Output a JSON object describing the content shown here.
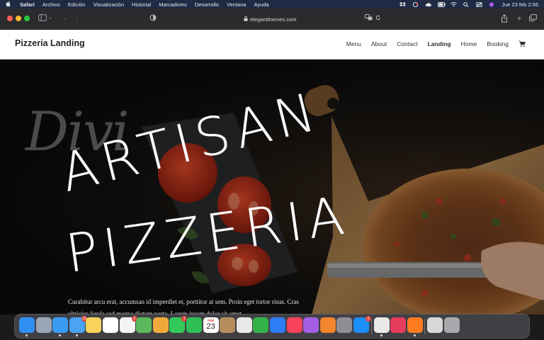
{
  "menubar": {
    "app_name": "Safari",
    "items": [
      "Archivo",
      "Edición",
      "Visualización",
      "Historial",
      "Marcadores",
      "Desarrollo",
      "Ventana",
      "Ayuda"
    ],
    "datetime": "Jue 23 feb 2:56"
  },
  "browser": {
    "url": "elegantthemes.com"
  },
  "site": {
    "title": "Pizzeria Landing",
    "nav": [
      "Menu",
      "About",
      "Contact",
      "Landing",
      "Home",
      "Booking"
    ],
    "active_nav": "Landing"
  },
  "hero": {
    "script_text": "Divi",
    "title_line1": "ARTISAN",
    "title_line2": "PIZZERIA",
    "body": "Curabitur arcu erat, accumsan id imperdiet et, porttitor at sem. Proin eget tortor risus. Cras ultricies ligula sed magna dictum porta. Lorem ipsum dolor sit amet."
  },
  "dock": {
    "apps": [
      {
        "icon": "finder-icon",
        "color": "#2f8ff0",
        "dot": true
      },
      {
        "icon": "launchpad-icon",
        "color": "#9aa5b8"
      },
      {
        "icon": "safari-icon",
        "color": "#3a9bf4",
        "dot": true
      },
      {
        "icon": "mail-icon",
        "color": "#4aa3f5",
        "badge": "10",
        "dot": true
      },
      {
        "icon": "notes-icon",
        "color": "#f7d35c"
      },
      {
        "icon": "freeform-icon",
        "color": "#ffffff"
      },
      {
        "icon": "reminders-icon",
        "color": "#f4f4f4",
        "badge": "2"
      },
      {
        "icon": "maps-icon",
        "color": "#5cb85c"
      },
      {
        "icon": "photos-icon",
        "color": "#f2a93b"
      },
      {
        "icon": "messages-icon",
        "color": "#34c759",
        "badge": "1"
      },
      {
        "icon": "facetime-icon",
        "color": "#2fbf55"
      },
      {
        "icon": "calendar-icon",
        "color": "#ffffff",
        "month": "FEB",
        "day": "23"
      },
      {
        "icon": "contacts-icon",
        "color": "#b68e5e"
      },
      {
        "icon": "keynote-icon",
        "color": "#e8e8e8"
      },
      {
        "icon": "numbers-icon",
        "color": "#33b24a"
      },
      {
        "icon": "keynote-podium-icon",
        "color": "#2e7cf6"
      },
      {
        "icon": "music-icon",
        "color": "#f9425b"
      },
      {
        "icon": "podcasts-icon",
        "color": "#a45ee5"
      },
      {
        "icon": "books-icon",
        "color": "#f3852d"
      },
      {
        "icon": "system-settings-icon",
        "color": "#8e8e93"
      },
      {
        "icon": "app-store-icon",
        "color": "#1c8ef9",
        "badge": "1"
      },
      {
        "icon": "chrome-icon",
        "color": "#e9e9e9",
        "dot": true
      },
      {
        "icon": "creative-cloud-icon",
        "color": "#e53b5c"
      },
      {
        "icon": "firefox-icon",
        "color": "#ff7b22",
        "dot": true
      },
      {
        "icon": "scanner-icon",
        "color": "#d8d8d8"
      },
      {
        "icon": "trash-icon",
        "color": "#a9a9ad"
      }
    ]
  },
  "colors": {
    "menubar_bg": "#1f2a44",
    "toolbar_bg": "#2b2b2e",
    "header_bg": "#ffffff",
    "hero_bg": "#0b0b0c",
    "hero_text": "#fbfbfb"
  }
}
